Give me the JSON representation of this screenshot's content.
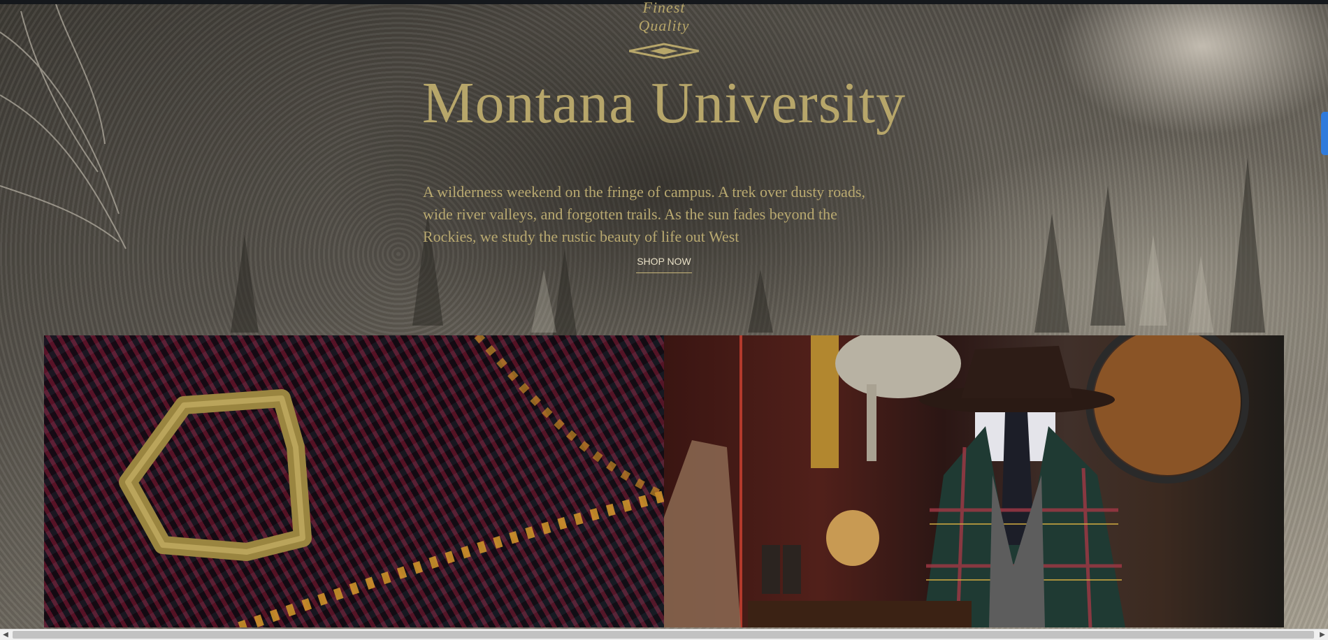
{
  "hero": {
    "tagline": "Finest Quality",
    "title": "Montana University",
    "description": "A wilderness weekend on the fringe of campus. A trek over dusty roads, wide river valleys, and forgotten trails. As the sun fades beyond the Rockies, we study the rustic beauty of life out West",
    "cta_label": "SHOP NOW"
  },
  "tiles": [
    {
      "subject": "tartan-belt-buckle-image"
    },
    {
      "subject": "tweed-outfit-mannequin-image"
    }
  ],
  "scrollbar": {
    "left_arrow": "◀",
    "right_arrow": "▶"
  },
  "colors": {
    "accent_gold": "#b7a66a",
    "scroll_marker": "#2f7bdc"
  }
}
